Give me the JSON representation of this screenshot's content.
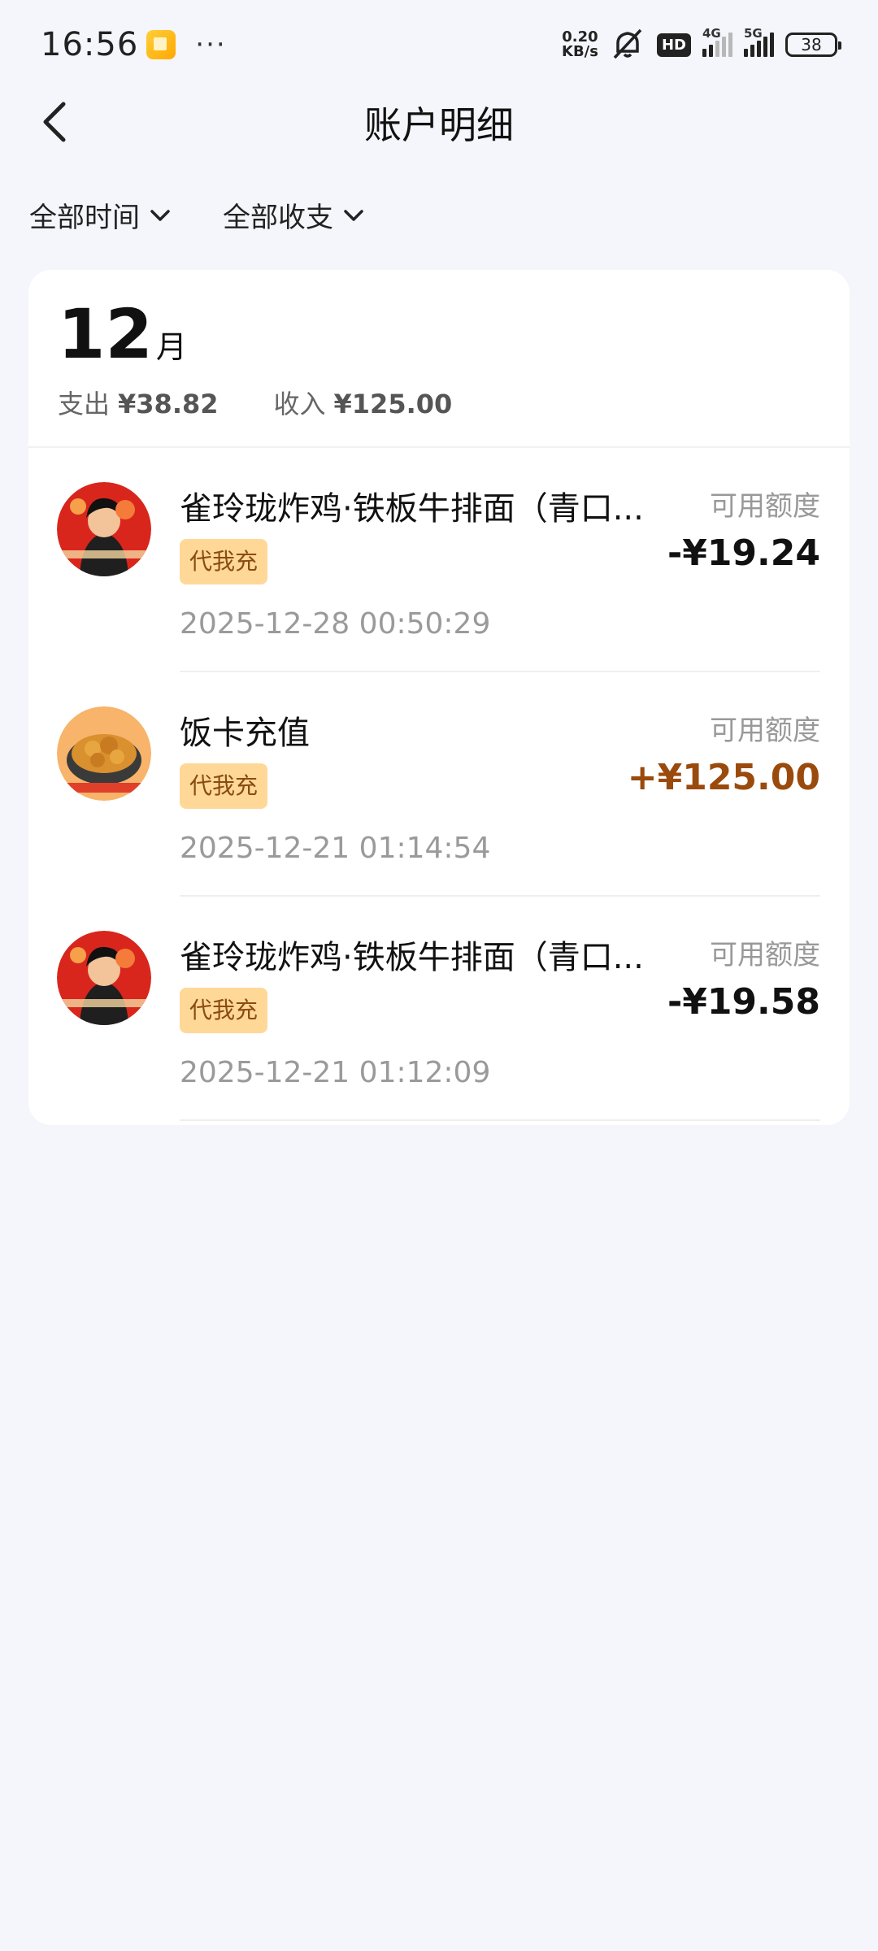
{
  "status_bar": {
    "time": "16:56",
    "more": "···",
    "net_speed_top": "0.20",
    "net_speed_bottom": "KB/s",
    "hd": "HD",
    "sig1_tag": "4G",
    "sig2_tag": "5G",
    "battery": "38"
  },
  "header": {
    "title": "账户明细"
  },
  "filters": {
    "time_label": "全部时间",
    "type_label": "全部收支"
  },
  "month": {
    "number": "12",
    "unit": "月",
    "expense_label": "支出",
    "expense_amount": "¥38.82",
    "income_label": "收入",
    "income_amount": "¥125.00"
  },
  "transactions": [
    {
      "title": "雀玲珑炸鸡·铁板牛排面（青口...",
      "badge": "代我充",
      "date": "2025-12-28 00:50:29",
      "label": "可用额度",
      "amount": "-¥19.24",
      "type": "expense"
    },
    {
      "title": "饭卡充值",
      "badge": "代我充",
      "date": "2025-12-21 01:14:54",
      "label": "可用额度",
      "amount": "+¥125.00",
      "type": "income"
    },
    {
      "title": "雀玲珑炸鸡·铁板牛排面（青口...",
      "badge": "代我充",
      "date": "2025-12-21 01:12:09",
      "label": "可用额度",
      "amount": "-¥19.58",
      "type": "expense"
    }
  ],
  "colors": {
    "background": "#f5f6fb",
    "badge_bg": "#ffd898",
    "badge_text": "#8a4b12",
    "income_amount": "#9a4a0c"
  }
}
